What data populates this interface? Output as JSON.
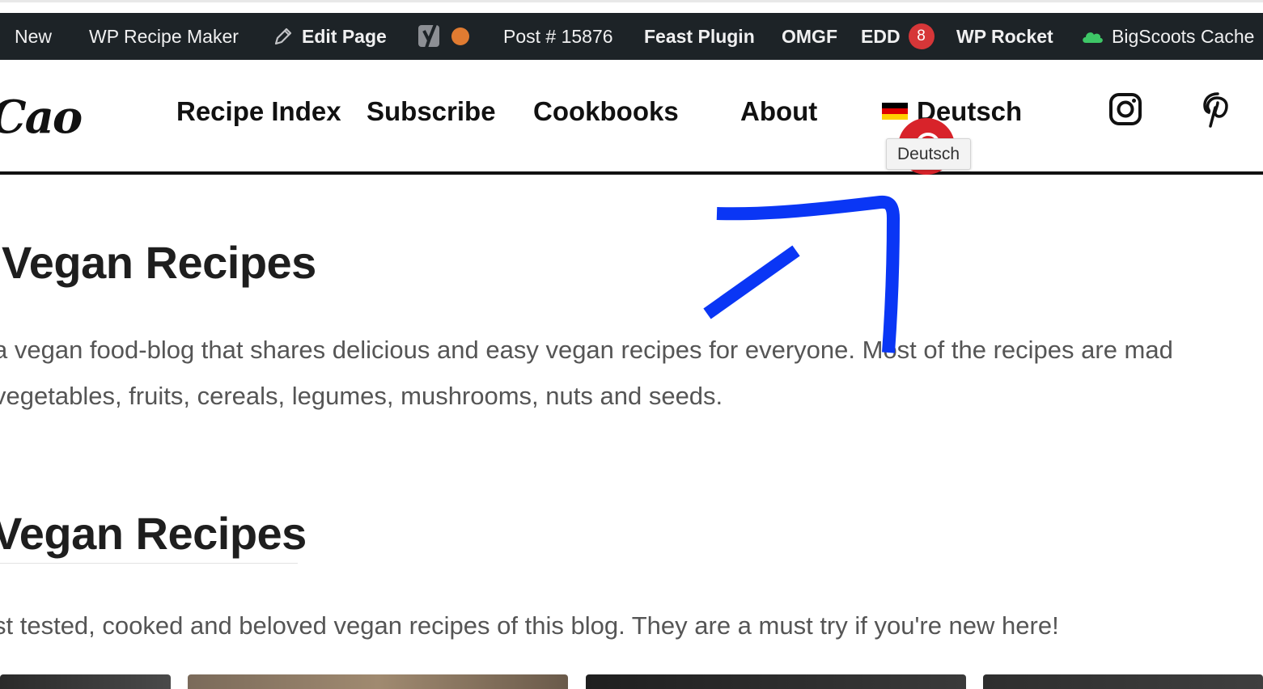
{
  "admin_bar": {
    "new": "New",
    "wp_recipe_maker": "WP Recipe Maker",
    "edit_page": "Edit Page",
    "post_id": "Post # 15876",
    "feast_plugin": "Feast Plugin",
    "omgf": "OMGF",
    "edd": "EDD",
    "edd_count": "8",
    "wp_rocket": "WP Rocket",
    "bigscoots_cache": "BigScoots Cache"
  },
  "header": {
    "logo": "Cao",
    "nav": [
      "Recipe Index",
      "Subscribe",
      "Cookbooks",
      "About",
      "Deutsch"
    ],
    "tooltip": "Deutsch"
  },
  "content": {
    "title": "Vegan Recipes",
    "intro_line1": "a vegan food-blog that shares delicious and easy vegan recipes for everyone. Most of the recipes are mad",
    "intro_line2": "vegetables, fruits, cereals, legumes, mushrooms, nuts and seeds.",
    "section_title": "Vegan Recipes",
    "section_text": "st tested, cooked and beloved vegan recipes of this blog. They are a must try if you're new here!"
  },
  "colors": {
    "admin_bar_bg": "#1d2327",
    "badge_red": "#d63638",
    "annotation_blue": "#0a36f5",
    "pinterest_red": "#d8232a"
  },
  "icons": [
    "pencil-icon",
    "yoast-icon",
    "status-dot-icon",
    "cloud-icon",
    "germany-flag-icon",
    "instagram-icon",
    "pinterest-icon"
  ]
}
